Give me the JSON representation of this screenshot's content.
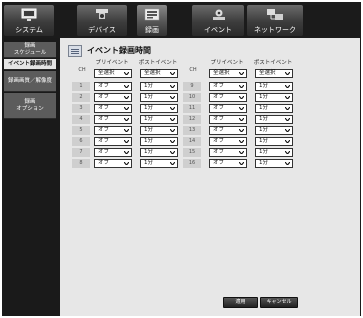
{
  "top_tabs": [
    {
      "label": "システム",
      "icon": "monitor-icon",
      "active": false
    },
    {
      "label": "デバイス",
      "icon": "camera-icon",
      "active": false
    },
    {
      "label": "録画",
      "icon": "recorder-icon",
      "active": true
    },
    {
      "label": "イベント",
      "icon": "event-camera-icon",
      "active": false
    },
    {
      "label": "ネットワーク",
      "icon": "network-icon",
      "active": false
    }
  ],
  "sidebar": {
    "items": [
      {
        "label": "録画\nスケジュール",
        "active": false
      },
      {
        "label": "イベント録画時間",
        "active": true
      },
      {
        "label": "録画画質／解像度",
        "active": false
      },
      {
        "label": "録画\nオプション",
        "active": false
      }
    ]
  },
  "page": {
    "title": "イベント録画時間"
  },
  "table": {
    "ch_header": "CH",
    "pre_header": "プリイベント",
    "post_header": "ポストイベント",
    "pre_all_value": "全選択",
    "post_all_value": "全選択",
    "left_rows": [
      {
        "ch": "1",
        "pre": "オフ",
        "post": "1分"
      },
      {
        "ch": "2",
        "pre": "オフ",
        "post": "1分"
      },
      {
        "ch": "3",
        "pre": "オフ",
        "post": "1分"
      },
      {
        "ch": "4",
        "pre": "オフ",
        "post": "1分"
      },
      {
        "ch": "5",
        "pre": "オフ",
        "post": "1分"
      },
      {
        "ch": "6",
        "pre": "オフ",
        "post": "1分"
      },
      {
        "ch": "7",
        "pre": "オフ",
        "post": "1分"
      },
      {
        "ch": "8",
        "pre": "オフ",
        "post": "1分"
      }
    ],
    "right_rows": [
      {
        "ch": "9",
        "pre": "オフ",
        "post": "1分"
      },
      {
        "ch": "10",
        "pre": "オフ",
        "post": "1分"
      },
      {
        "ch": "11",
        "pre": "オフ",
        "post": "1分"
      },
      {
        "ch": "12",
        "pre": "オフ",
        "post": "1分"
      },
      {
        "ch": "13",
        "pre": "オフ",
        "post": "1分"
      },
      {
        "ch": "14",
        "pre": "オフ",
        "post": "1分"
      },
      {
        "ch": "15",
        "pre": "オフ",
        "post": "1分"
      },
      {
        "ch": "16",
        "pre": "オフ",
        "post": "1分"
      }
    ]
  },
  "buttons": {
    "apply": "適用",
    "cancel": "キャンセル"
  }
}
